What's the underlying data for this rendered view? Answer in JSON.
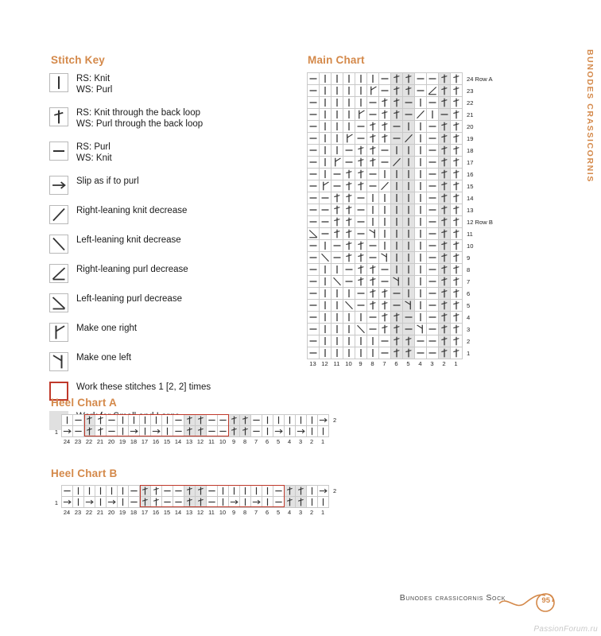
{
  "sections": {
    "stitch_key_title": "Stitch Key",
    "main_chart_title": "Main Chart",
    "heel_a_title": "Heel Chart A",
    "heel_b_title": "Heel Chart B"
  },
  "side_running_head": "BUNODES CRASSICORNIS",
  "footer": {
    "text": "Bunodes crassicornis Sock",
    "page_number": "95"
  },
  "watermark": "PassionForum.ru",
  "colors": {
    "accent": "#d4894a",
    "red_box": "#c0392b",
    "shaded_cell": "#e2e2e2",
    "grid_line": "#c9c9c9",
    "text": "#1a1a1a"
  },
  "stitch_key": [
    {
      "symbol": "knit",
      "box": "normal",
      "label": "RS: Knit\nWS: Purl"
    },
    {
      "symbol": "knit-tbl",
      "box": "normal",
      "label": "RS: Knit through the back loop\nWS: Purl through the back loop"
    },
    {
      "symbol": "purl",
      "box": "normal",
      "label": "RS: Purl\nWS: Knit"
    },
    {
      "symbol": "slip",
      "box": "normal",
      "label": "Slip as if to purl"
    },
    {
      "symbol": "k-dec-right",
      "box": "normal",
      "label": "Right-leaning knit decrease"
    },
    {
      "symbol": "k-dec-left",
      "box": "normal",
      "label": "Left-leaning knit decrease"
    },
    {
      "symbol": "p-dec-right",
      "box": "normal",
      "label": "Right-leaning purl decrease"
    },
    {
      "symbol": "p-dec-left",
      "box": "normal",
      "label": "Left-leaning purl decrease"
    },
    {
      "symbol": "m1r",
      "box": "normal",
      "label": "Make one right"
    },
    {
      "symbol": "m1l",
      "box": "normal",
      "label": "Make one left"
    },
    {
      "symbol": "blank",
      "box": "red",
      "label": "Work these stitches 1 [2, 2] times"
    },
    {
      "symbol": "blank",
      "box": "gray",
      "label": "Work for Small and Large"
    }
  ],
  "main_chart": {
    "columns": 13,
    "column_labels": [
      "13",
      "12",
      "11",
      "10",
      "9",
      "8",
      "7",
      "6",
      "5",
      "4",
      "3",
      "2",
      "1"
    ],
    "shaded_columns": [
      6,
      5,
      2
    ],
    "rows": [
      {
        "label": "24 Row A",
        "cells": [
          "purl",
          "knit",
          "knit",
          "knit",
          "knit",
          "knit",
          "purl",
          "knit-tbl",
          "knit-tbl",
          "purl",
          "purl",
          "knit-tbl",
          "knit-tbl"
        ]
      },
      {
        "label": "23",
        "cells": [
          "purl",
          "knit",
          "knit",
          "knit",
          "knit",
          "m1r",
          "purl",
          "knit-tbl",
          "knit-tbl",
          "purl",
          "p-dec-right",
          "knit-tbl",
          "knit-tbl"
        ]
      },
      {
        "label": "22",
        "cells": [
          "purl",
          "knit",
          "knit",
          "knit",
          "knit",
          "purl",
          "knit-tbl",
          "knit-tbl",
          "purl",
          "knit",
          "purl",
          "knit-tbl",
          "knit-tbl"
        ]
      },
      {
        "label": "21",
        "cells": [
          "purl",
          "knit",
          "knit",
          "knit",
          "m1r",
          "purl",
          "knit-tbl",
          "knit-tbl",
          "purl",
          "k-dec-right",
          "knit",
          "purl",
          "knit-tbl"
        ]
      },
      {
        "label": "20",
        "cells": [
          "purl",
          "knit",
          "knit",
          "knit",
          "purl",
          "knit-tbl",
          "knit-tbl",
          "purl",
          "knit",
          "knit",
          "purl",
          "knit-tbl",
          "knit-tbl"
        ]
      },
      {
        "label": "19",
        "cells": [
          "purl",
          "knit",
          "knit",
          "m1r",
          "purl",
          "knit-tbl",
          "knit-tbl",
          "purl",
          "k-dec-right",
          "knit",
          "purl",
          "knit-tbl",
          "knit-tbl"
        ]
      },
      {
        "label": "18",
        "cells": [
          "purl",
          "knit",
          "knit",
          "purl",
          "knit-tbl",
          "knit-tbl",
          "purl",
          "knit",
          "knit",
          "knit",
          "purl",
          "knit-tbl",
          "knit-tbl"
        ]
      },
      {
        "label": "17",
        "cells": [
          "purl",
          "knit",
          "m1r",
          "purl",
          "knit-tbl",
          "knit-tbl",
          "purl",
          "k-dec-right",
          "knit",
          "knit",
          "purl",
          "knit-tbl",
          "knit-tbl"
        ]
      },
      {
        "label": "16",
        "cells": [
          "purl",
          "knit",
          "purl",
          "knit-tbl",
          "knit-tbl",
          "purl",
          "knit",
          "knit",
          "knit",
          "knit",
          "purl",
          "knit-tbl",
          "knit-tbl"
        ]
      },
      {
        "label": "15",
        "cells": [
          "purl",
          "m1r",
          "purl",
          "knit-tbl",
          "knit-tbl",
          "purl",
          "k-dec-right",
          "knit",
          "knit",
          "knit",
          "purl",
          "knit-tbl",
          "knit-tbl"
        ]
      },
      {
        "label": "14",
        "cells": [
          "purl",
          "purl",
          "knit-tbl",
          "knit-tbl",
          "purl",
          "knit",
          "knit",
          "knit",
          "knit",
          "knit",
          "purl",
          "knit-tbl",
          "knit-tbl"
        ]
      },
      {
        "label": "13",
        "cells": [
          "purl",
          "purl",
          "knit-tbl",
          "knit-tbl",
          "purl",
          "knit",
          "knit",
          "knit",
          "knit",
          "knit",
          "purl",
          "knit-tbl",
          "knit-tbl"
        ]
      },
      {
        "label": "12 Row B",
        "cells": [
          "purl",
          "purl",
          "knit-tbl",
          "knit-tbl",
          "purl",
          "knit",
          "knit",
          "knit",
          "knit",
          "knit",
          "purl",
          "knit-tbl",
          "knit-tbl"
        ]
      },
      {
        "label": "11",
        "cells": [
          "p-dec-left",
          "purl",
          "knit-tbl",
          "knit-tbl",
          "purl",
          "m1l",
          "knit",
          "knit",
          "knit",
          "knit",
          "purl",
          "knit-tbl",
          "knit-tbl"
        ]
      },
      {
        "label": "10",
        "cells": [
          "purl",
          "knit",
          "purl",
          "knit-tbl",
          "knit-tbl",
          "purl",
          "knit",
          "knit",
          "knit",
          "knit",
          "purl",
          "knit-tbl",
          "knit-tbl"
        ]
      },
      {
        "label": "9",
        "cells": [
          "purl",
          "k-dec-left",
          "purl",
          "knit-tbl",
          "knit-tbl",
          "purl",
          "m1l",
          "knit",
          "knit",
          "knit",
          "purl",
          "knit-tbl",
          "knit-tbl"
        ]
      },
      {
        "label": "8",
        "cells": [
          "purl",
          "knit",
          "knit",
          "purl",
          "knit-tbl",
          "knit-tbl",
          "purl",
          "knit",
          "knit",
          "knit",
          "purl",
          "knit-tbl",
          "knit-tbl"
        ]
      },
      {
        "label": "7",
        "cells": [
          "purl",
          "knit",
          "k-dec-left",
          "purl",
          "knit-tbl",
          "knit-tbl",
          "purl",
          "m1l",
          "knit",
          "knit",
          "purl",
          "knit-tbl",
          "knit-tbl"
        ]
      },
      {
        "label": "6",
        "cells": [
          "purl",
          "knit",
          "knit",
          "knit",
          "purl",
          "knit-tbl",
          "knit-tbl",
          "purl",
          "knit",
          "knit",
          "purl",
          "knit-tbl",
          "knit-tbl"
        ]
      },
      {
        "label": "5",
        "cells": [
          "purl",
          "knit",
          "knit",
          "k-dec-left",
          "purl",
          "knit-tbl",
          "knit-tbl",
          "purl",
          "m1l",
          "knit",
          "purl",
          "knit-tbl",
          "knit-tbl"
        ]
      },
      {
        "label": "4",
        "cells": [
          "purl",
          "knit",
          "knit",
          "knit",
          "knit",
          "purl",
          "knit-tbl",
          "knit-tbl",
          "purl",
          "knit",
          "purl",
          "knit-tbl",
          "knit-tbl"
        ]
      },
      {
        "label": "3",
        "cells": [
          "purl",
          "knit",
          "knit",
          "knit",
          "k-dec-left",
          "purl",
          "knit-tbl",
          "knit-tbl",
          "purl",
          "m1l",
          "purl",
          "knit-tbl",
          "knit-tbl"
        ]
      },
      {
        "label": "2",
        "cells": [
          "purl",
          "knit",
          "knit",
          "knit",
          "knit",
          "knit",
          "purl",
          "knit-tbl",
          "knit-tbl",
          "purl",
          "purl",
          "knit-tbl",
          "knit-tbl"
        ]
      },
      {
        "label": "1",
        "cells": [
          "purl",
          "knit",
          "knit",
          "knit",
          "knit",
          "knit",
          "purl",
          "knit-tbl",
          "knit-tbl",
          "purl",
          "purl",
          "knit-tbl",
          "knit-tbl"
        ]
      }
    ]
  },
  "heel_chart_a": {
    "columns": 24,
    "column_labels": [
      "24",
      "23",
      "22",
      "21",
      "20",
      "19",
      "18",
      "17",
      "16",
      "15",
      "14",
      "13",
      "12",
      "11",
      "10",
      "9",
      "8",
      "7",
      "6",
      "5",
      "4",
      "3",
      "2",
      "1"
    ],
    "shaded_columns": [
      22,
      13,
      12,
      9,
      8
    ],
    "red_box": {
      "from_column": 22,
      "to_column": 10
    },
    "rows": [
      {
        "label": "2",
        "cells": [
          "knit",
          "purl",
          "knit-tbl",
          "knit-tbl",
          "purl",
          "knit",
          "knit",
          "knit",
          "knit",
          "knit",
          "purl",
          "knit-tbl",
          "knit-tbl",
          "purl",
          "purl",
          "knit-tbl",
          "knit-tbl",
          "purl",
          "knit",
          "knit",
          "knit",
          "knit",
          "knit",
          "slip"
        ]
      },
      {
        "label": "1",
        "cells": [
          "slip",
          "purl",
          "knit-tbl",
          "knit-tbl",
          "purl",
          "knit",
          "slip",
          "knit",
          "slip",
          "knit",
          "purl",
          "knit-tbl",
          "knit-tbl",
          "purl",
          "purl",
          "knit-tbl",
          "knit-tbl",
          "purl",
          "knit",
          "slip",
          "knit",
          "slip",
          "knit",
          "knit"
        ]
      }
    ]
  },
  "heel_chart_b": {
    "columns": 24,
    "column_labels": [
      "24",
      "23",
      "22",
      "21",
      "20",
      "19",
      "18",
      "17",
      "16",
      "15",
      "14",
      "13",
      "12",
      "11",
      "10",
      "9",
      "8",
      "7",
      "6",
      "5",
      "4",
      "3",
      "2",
      "1"
    ],
    "shaded_columns": [
      17,
      13,
      12,
      4,
      3
    ],
    "red_box": {
      "from_column": 17,
      "to_column": 5
    },
    "rows": [
      {
        "label": "2",
        "cells": [
          "purl",
          "knit",
          "knit",
          "knit",
          "knit",
          "knit",
          "purl",
          "knit-tbl",
          "knit-tbl",
          "purl",
          "purl",
          "knit-tbl",
          "knit-tbl",
          "purl",
          "knit",
          "knit",
          "knit",
          "knit",
          "knit",
          "purl",
          "knit-tbl",
          "knit-tbl",
          "knit",
          "slip"
        ]
      },
      {
        "label": "1",
        "cells": [
          "slip",
          "knit",
          "slip",
          "knit",
          "slip",
          "knit",
          "purl",
          "knit-tbl",
          "knit-tbl",
          "purl",
          "purl",
          "knit-tbl",
          "knit-tbl",
          "purl",
          "knit",
          "slip",
          "knit",
          "slip",
          "knit",
          "purl",
          "knit-tbl",
          "knit-tbl",
          "knit",
          "knit"
        ]
      }
    ]
  }
}
